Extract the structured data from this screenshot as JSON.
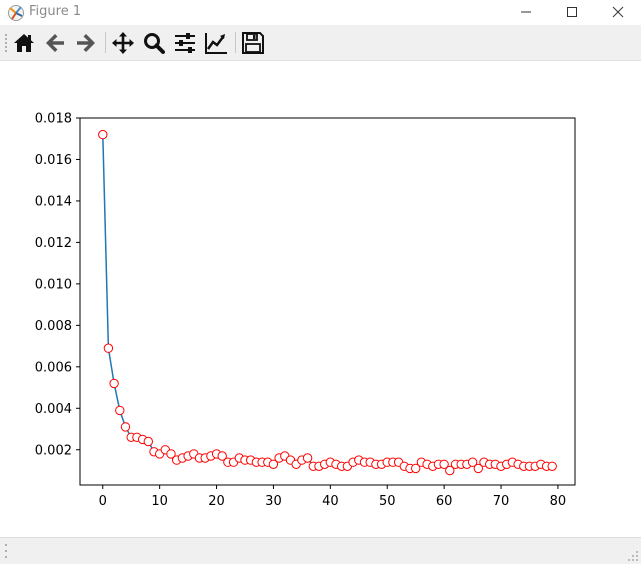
{
  "window": {
    "title": "Figure 1"
  },
  "toolbar": {
    "items": [
      {
        "name": "home-icon"
      },
      {
        "name": "back-icon"
      },
      {
        "name": "forward-icon"
      },
      {
        "name": "pan-icon"
      },
      {
        "name": "zoom-icon"
      },
      {
        "name": "configure-subplots-icon"
      },
      {
        "name": "edit-axis-icon"
      },
      {
        "name": "save-icon"
      }
    ]
  },
  "colors": {
    "line": "#1f77b4",
    "marker_edge": "#ff0000",
    "marker_face": "#ffffff"
  },
  "chart_data": {
    "type": "line",
    "title": "",
    "xlabel": "",
    "ylabel": "",
    "xlim": [
      -4,
      83
    ],
    "ylim": [
      0.0003,
      0.018
    ],
    "xticks": [
      0,
      10,
      20,
      30,
      40,
      50,
      60,
      70,
      80
    ],
    "xtick_labels": [
      "0",
      "10",
      "20",
      "30",
      "40",
      "50",
      "60",
      "70",
      "80"
    ],
    "yticks": [
      0.002,
      0.004,
      0.006,
      0.008,
      0.01,
      0.012,
      0.014,
      0.016,
      0.018
    ],
    "ytick_labels": [
      "0.002",
      "0.004",
      "0.006",
      "0.008",
      "0.010",
      "0.012",
      "0.014",
      "0.016",
      "0.018"
    ],
    "grid": false,
    "legend": "none",
    "x": [
      0,
      1,
      2,
      3,
      4,
      5,
      6,
      7,
      8,
      9,
      10,
      11,
      12,
      13,
      14,
      15,
      16,
      17,
      18,
      19,
      20,
      21,
      22,
      23,
      24,
      25,
      26,
      27,
      28,
      29,
      30,
      31,
      32,
      33,
      34,
      35,
      36,
      37,
      38,
      39,
      40,
      41,
      42,
      43,
      44,
      45,
      46,
      47,
      48,
      49,
      50,
      51,
      52,
      53,
      54,
      55,
      56,
      57,
      58,
      59,
      60,
      61,
      62,
      63,
      64,
      65,
      66,
      67,
      68,
      69,
      70,
      71,
      72,
      73,
      74,
      75,
      76,
      77,
      78,
      79
    ],
    "y": [
      0.0172,
      0.0069,
      0.0052,
      0.0039,
      0.0031,
      0.0026,
      0.0026,
      0.0025,
      0.0024,
      0.0019,
      0.0018,
      0.002,
      0.0018,
      0.0015,
      0.0016,
      0.0017,
      0.0018,
      0.0016,
      0.0016,
      0.0017,
      0.0018,
      0.0017,
      0.0014,
      0.0014,
      0.0016,
      0.0015,
      0.0015,
      0.0014,
      0.0014,
      0.0014,
      0.0013,
      0.0016,
      0.0017,
      0.0015,
      0.0013,
      0.0015,
      0.0016,
      0.0012,
      0.0012,
      0.0013,
      0.0014,
      0.0013,
      0.0012,
      0.0012,
      0.0014,
      0.0015,
      0.0014,
      0.0014,
      0.0013,
      0.0013,
      0.0014,
      0.0014,
      0.0014,
      0.0012,
      0.0011,
      0.0011,
      0.0014,
      0.0013,
      0.0012,
      0.0013,
      0.0013,
      0.001,
      0.0013,
      0.0013,
      0.0013,
      0.0014,
      0.0011,
      0.0014,
      0.0013,
      0.0013,
      0.0012,
      0.0013,
      0.0014,
      0.0013,
      0.0012,
      0.0012,
      0.0012,
      0.0013,
      0.0012,
      0.0012
    ]
  }
}
